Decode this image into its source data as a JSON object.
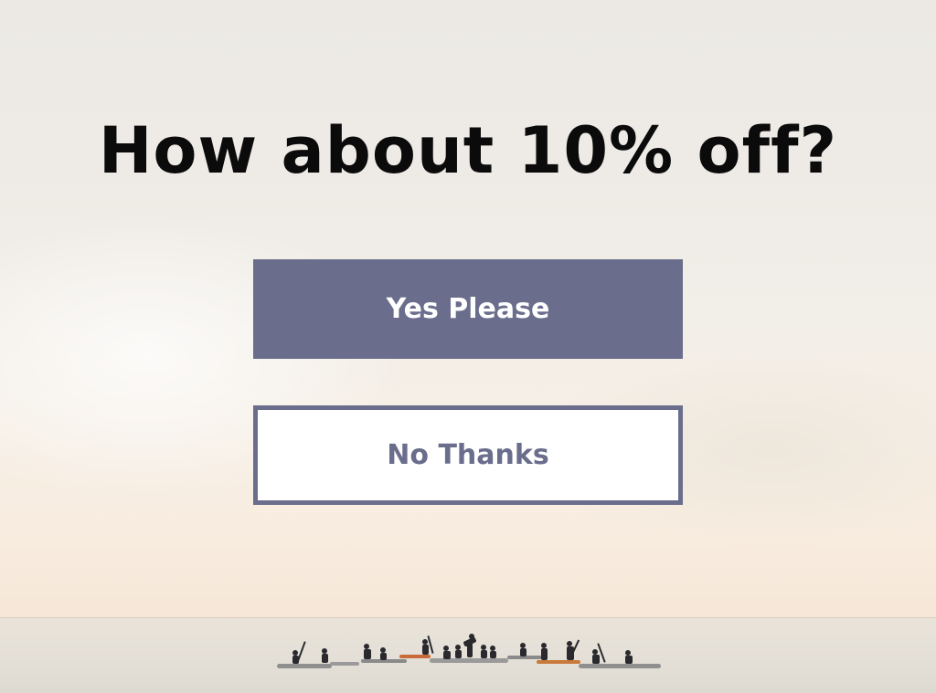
{
  "popup": {
    "headline": "How about 10% off?",
    "yes_label": "Yes Please",
    "no_label": "No Thanks"
  },
  "colors": {
    "accent": "#6a6d8c",
    "headline_text": "#0b0b0b",
    "button_text_primary": "#ffffff",
    "secondary_button_background": "#ffffff"
  },
  "background": {
    "description_icon": "kayakers-on-sea-photo"
  }
}
